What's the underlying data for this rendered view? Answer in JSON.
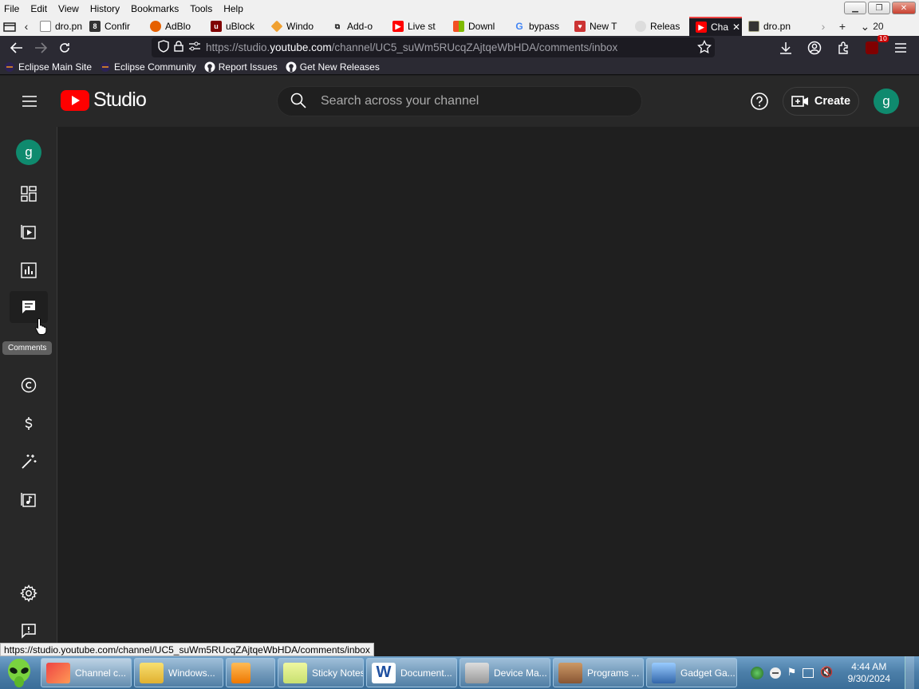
{
  "menubar": {
    "items": [
      "File",
      "Edit",
      "View",
      "History",
      "Bookmarks",
      "Tools",
      "Help"
    ]
  },
  "tabs": [
    {
      "label": "dro.pn"
    },
    {
      "label": "Confir"
    },
    {
      "label": "AdBlo"
    },
    {
      "label": "uBlock"
    },
    {
      "label": "Windo"
    },
    {
      "label": "Add-o"
    },
    {
      "label": "Live st"
    },
    {
      "label": "Downl"
    },
    {
      "label": "bypass"
    },
    {
      "label": "New T"
    },
    {
      "label": "Releas"
    },
    {
      "label": "Cha",
      "active": true
    },
    {
      "label": "dro.pn"
    }
  ],
  "tab_overflow_count": "20",
  "navbar": {
    "url_prefix": "https://studio.",
    "url_domain": "youtube.com",
    "url_path": "/channel/UC5_suWm5RUcqZAjtqeWbHDA/comments/inbox",
    "extension_badge": "10"
  },
  "bookmarks": [
    {
      "label": "Eclipse Main Site"
    },
    {
      "label": "Eclipse Community"
    },
    {
      "label": "Report Issues"
    },
    {
      "label": "Get New Releases"
    }
  ],
  "studio": {
    "logo_text": "Studio",
    "search_placeholder": "Search across your channel",
    "create_label": "Create",
    "avatar_letter": "g",
    "sidebar_avatar_letter": "g",
    "tooltip": "Comments"
  },
  "status_link": "https://studio.youtube.com/channel/UC5_suWm5RUcqZAjtqeWbHDA/comments/inbox",
  "taskbar": {
    "buttons": [
      {
        "label": "Channel c...",
        "active": true
      },
      {
        "label": "Windows..."
      },
      {
        "label": ""
      },
      {
        "label": "Sticky Notes"
      },
      {
        "label": "Document..."
      },
      {
        "label": "Device Ma..."
      },
      {
        "label": "Programs ..."
      },
      {
        "label": "Gadget Ga..."
      }
    ],
    "time": "4:44 AM",
    "date": "9/30/2024"
  },
  "colors": {
    "youtube_red": "#ff0000",
    "avatar_green": "#0f8a6e",
    "studio_bg": "#1f1f1f",
    "header_bg": "#282828"
  }
}
